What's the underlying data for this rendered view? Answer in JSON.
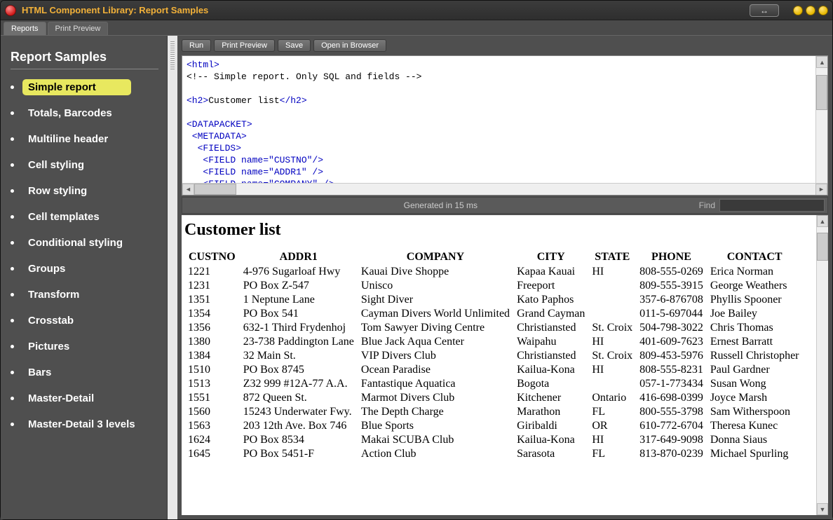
{
  "window": {
    "title": "HTML Component Library: Report Samples"
  },
  "tabs": [
    {
      "label": "Reports",
      "active": true
    },
    {
      "label": "Print Preview",
      "active": false
    }
  ],
  "sidebar": {
    "title": "Report Samples",
    "items": [
      {
        "label": "Simple report",
        "active": true
      },
      {
        "label": "Totals, Barcodes"
      },
      {
        "label": "Multiline header"
      },
      {
        "label": "Cell styling"
      },
      {
        "label": "Row styling"
      },
      {
        "label": "Cell templates"
      },
      {
        "label": "Conditional styling"
      },
      {
        "label": "Groups"
      },
      {
        "label": "Transform"
      },
      {
        "label": "Crosstab"
      },
      {
        "label": "Pictures"
      },
      {
        "label": "Bars"
      },
      {
        "label": "Master-Detail"
      },
      {
        "label": "Master-Detail 3 levels"
      }
    ]
  },
  "toolbar": {
    "run": "Run",
    "print_preview": "Print Preview",
    "save": "Save",
    "open_in_browser": "Open in Browser"
  },
  "code": {
    "line1": "<html>",
    "line2": "<!-- Simple report. Only SQL and fields -->",
    "line3": "",
    "line4_open": "<h2>",
    "line4_text": "Customer list",
    "line4_close": "</h2>",
    "line5": "",
    "line6": "<DATAPACKET>",
    "line7": " <METADATA>",
    "line8": "  <FIELDS>",
    "line9": "   <FIELD name=\"CUSTNO\"/>",
    "line10": "   <FIELD name=\"ADDR1\" />",
    "line11": "   <FIELD name=\"COMPANY\" />"
  },
  "status": {
    "generated": "Generated in 15 ms",
    "find_label": "Find"
  },
  "report": {
    "title": "Customer list",
    "columns": [
      "CUSTNO",
      "ADDR1",
      "COMPANY",
      "CITY",
      "STATE",
      "PHONE",
      "CONTACT"
    ],
    "rows": [
      {
        "CUSTNO": "1221",
        "ADDR1": "4-976 Sugarloaf Hwy",
        "COMPANY": "Kauai Dive Shoppe",
        "CITY": "Kapaa Kauai",
        "STATE": "HI",
        "PHONE": "808-555-0269",
        "CONTACT": "Erica Norman"
      },
      {
        "CUSTNO": "1231",
        "ADDR1": "PO Box Z-547",
        "COMPANY": "Unisco",
        "CITY": "Freeport",
        "STATE": "",
        "PHONE": "809-555-3915",
        "CONTACT": "George Weathers"
      },
      {
        "CUSTNO": "1351",
        "ADDR1": "1 Neptune Lane",
        "COMPANY": "Sight Diver",
        "CITY": "Kato Paphos",
        "STATE": "",
        "PHONE": "357-6-876708",
        "CONTACT": "Phyllis Spooner"
      },
      {
        "CUSTNO": "1354",
        "ADDR1": "PO Box 541",
        "COMPANY": "Cayman Divers World Unlimited",
        "CITY": "Grand Cayman",
        "STATE": "",
        "PHONE": "011-5-697044",
        "CONTACT": "Joe Bailey"
      },
      {
        "CUSTNO": "1356",
        "ADDR1": "632-1 Third Frydenhoj",
        "COMPANY": "Tom Sawyer Diving Centre",
        "CITY": "Christiansted",
        "STATE": "St. Croix",
        "PHONE": "504-798-3022",
        "CONTACT": "Chris Thomas"
      },
      {
        "CUSTNO": "1380",
        "ADDR1": "23-738 Paddington Lane",
        "COMPANY": "Blue Jack Aqua Center",
        "CITY": "Waipahu",
        "STATE": "HI",
        "PHONE": "401-609-7623",
        "CONTACT": "Ernest Barratt"
      },
      {
        "CUSTNO": "1384",
        "ADDR1": "32 Main St.",
        "COMPANY": "VIP Divers Club",
        "CITY": "Christiansted",
        "STATE": "St. Croix",
        "PHONE": "809-453-5976",
        "CONTACT": "Russell Christopher"
      },
      {
        "CUSTNO": "1510",
        "ADDR1": "PO Box 8745",
        "COMPANY": "Ocean Paradise",
        "CITY": "Kailua-Kona",
        "STATE": "HI",
        "PHONE": "808-555-8231",
        "CONTACT": "Paul Gardner"
      },
      {
        "CUSTNO": "1513",
        "ADDR1": "Z32 999 #12A-77 A.A.",
        "COMPANY": "Fantastique Aquatica",
        "CITY": "Bogota",
        "STATE": "",
        "PHONE": "057-1-773434",
        "CONTACT": "Susan Wong"
      },
      {
        "CUSTNO": "1551",
        "ADDR1": "872 Queen St.",
        "COMPANY": "Marmot Divers Club",
        "CITY": "Kitchener",
        "STATE": "Ontario",
        "PHONE": "416-698-0399",
        "CONTACT": "Joyce Marsh"
      },
      {
        "CUSTNO": "1560",
        "ADDR1": "15243 Underwater Fwy.",
        "COMPANY": "The Depth Charge",
        "CITY": "Marathon",
        "STATE": "FL",
        "PHONE": "800-555-3798",
        "CONTACT": "Sam Witherspoon"
      },
      {
        "CUSTNO": "1563",
        "ADDR1": "203 12th Ave. Box 746",
        "COMPANY": "Blue Sports",
        "CITY": "Giribaldi",
        "STATE": "OR",
        "PHONE": "610-772-6704",
        "CONTACT": "Theresa Kunec"
      },
      {
        "CUSTNO": "1624",
        "ADDR1": "PO Box 8534",
        "COMPANY": "Makai SCUBA Club",
        "CITY": "Kailua-Kona",
        "STATE": "HI",
        "PHONE": "317-649-9098",
        "CONTACT": "Donna Siaus"
      },
      {
        "CUSTNO": "1645",
        "ADDR1": "PO Box 5451-F",
        "COMPANY": "Action Club",
        "CITY": "Sarasota",
        "STATE": "FL",
        "PHONE": "813-870-0239",
        "CONTACT": "Michael Spurling"
      }
    ]
  }
}
